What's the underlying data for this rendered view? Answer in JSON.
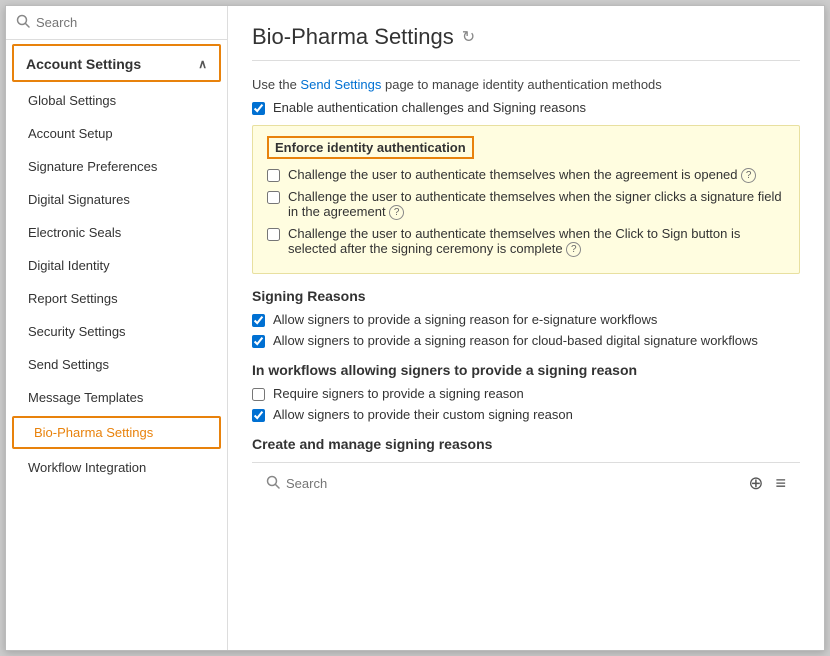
{
  "page": {
    "title": "Bio-Pharma Settings",
    "refresh_icon": "↻"
  },
  "sidebar": {
    "search_placeholder": "Search",
    "section_header": "Account Settings",
    "chevron": "∧",
    "items": [
      {
        "label": "Global Settings",
        "active": false
      },
      {
        "label": "Account Setup",
        "active": false
      },
      {
        "label": "Signature Preferences",
        "active": false
      },
      {
        "label": "Digital Signatures",
        "active": false
      },
      {
        "label": "Electronic Seals",
        "active": false
      },
      {
        "label": "Digital Identity",
        "active": false
      },
      {
        "label": "Report Settings",
        "active": false
      },
      {
        "label": "Security Settings",
        "active": false
      },
      {
        "label": "Send Settings",
        "active": false
      },
      {
        "label": "Message Templates",
        "active": false
      },
      {
        "label": "Bio-Pharma Settings",
        "active": true
      },
      {
        "label": "Workflow Integration",
        "active": false
      }
    ]
  },
  "main": {
    "description_prefix": "Use the ",
    "description_link": "Send Settings",
    "description_suffix": " page to manage identity authentication methods",
    "enable_auth_label": "Enable authentication challenges and Signing reasons",
    "enforce_section": {
      "header": "Enforce identity authentication",
      "checkboxes": [
        {
          "label": "Challenge the user to authenticate themselves when the agreement is opened",
          "checked": false,
          "has_help": true
        },
        {
          "label": "Challenge the user to authenticate themselves when the signer clicks a signature field in the agreement",
          "checked": false,
          "has_help": true
        },
        {
          "label": "Challenge the user to authenticate themselves when the Click to Sign button is selected after the signing ceremony is complete",
          "checked": false,
          "has_help": true
        }
      ]
    },
    "signing_reasons": {
      "title": "Signing Reasons",
      "checkboxes": [
        {
          "label": "Allow signers to provide a signing reason for e-signature workflows",
          "checked": true
        },
        {
          "label": "Allow signers to provide a signing reason for cloud-based digital signature workflows",
          "checked": true
        }
      ]
    },
    "in_workflows": {
      "title": "In workflows allowing signers to provide a signing reason",
      "checkboxes": [
        {
          "label": "Require signers to provide a signing reason",
          "checked": false
        },
        {
          "label": "Allow signers to provide their custom signing reason",
          "checked": true
        }
      ]
    },
    "create_manage": {
      "title": "Create and manage signing reasons"
    },
    "bottom_search_placeholder": "Search",
    "bottom_add_icon": "⊕",
    "bottom_menu_icon": "≡"
  }
}
